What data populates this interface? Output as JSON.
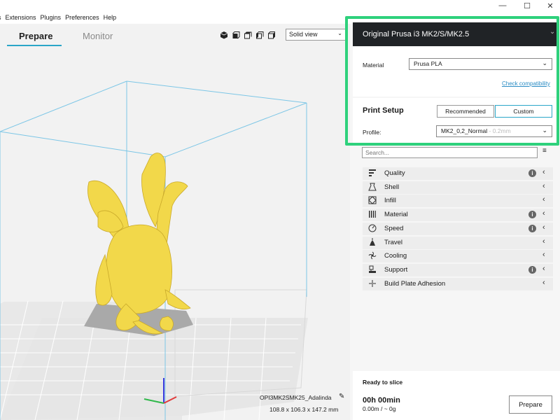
{
  "menu": [
    "s",
    "Extensions",
    "Plugins",
    "Preferences",
    "Help"
  ],
  "window": {
    "minimize": "—",
    "maximize": "☐",
    "close": "✕"
  },
  "tabs": {
    "prepare": "Prepare",
    "monitor": "Monitor"
  },
  "view": {
    "mode": "Solid view"
  },
  "object": {
    "name": "OPI3MK2SMK25_Adalinda",
    "dimensions": "108.8 x 106.3 x 147.2 mm"
  },
  "printer": {
    "name": "Original Prusa i3 MK2/S/MK2.5"
  },
  "material": {
    "label": "Material",
    "value": "Prusa PLA",
    "check_link": "Check compatibility"
  },
  "print_setup": {
    "title": "Print Setup",
    "recommended": "Recommended",
    "custom": "Custom",
    "profile_label": "Profile:",
    "profile_value": "MK2_0,2_Normal",
    "profile_suffix": "- 0.2mm"
  },
  "search": {
    "placeholder": "Search..."
  },
  "categories": [
    {
      "label": "Quality",
      "icon": "quality-icon",
      "info": true
    },
    {
      "label": "Shell",
      "icon": "shell-icon",
      "info": false
    },
    {
      "label": "Infill",
      "icon": "infill-icon",
      "info": false
    },
    {
      "label": "Material",
      "icon": "material-icon",
      "info": true
    },
    {
      "label": "Speed",
      "icon": "speed-icon",
      "info": true
    },
    {
      "label": "Travel",
      "icon": "travel-icon",
      "info": false
    },
    {
      "label": "Cooling",
      "icon": "cooling-icon",
      "info": false
    },
    {
      "label": "Support",
      "icon": "support-icon",
      "info": true
    },
    {
      "label": "Build Plate Adhesion",
      "icon": "adhesion-icon",
      "info": false
    }
  ],
  "slice": {
    "status": "Ready to slice",
    "time": "00h 00min",
    "material_usage": "0.00m / ~ 0g",
    "button": "Prepare"
  },
  "colors": {
    "accent": "#2ba6c8",
    "highlight": "#2ed17c",
    "model": "#f2d84a"
  }
}
